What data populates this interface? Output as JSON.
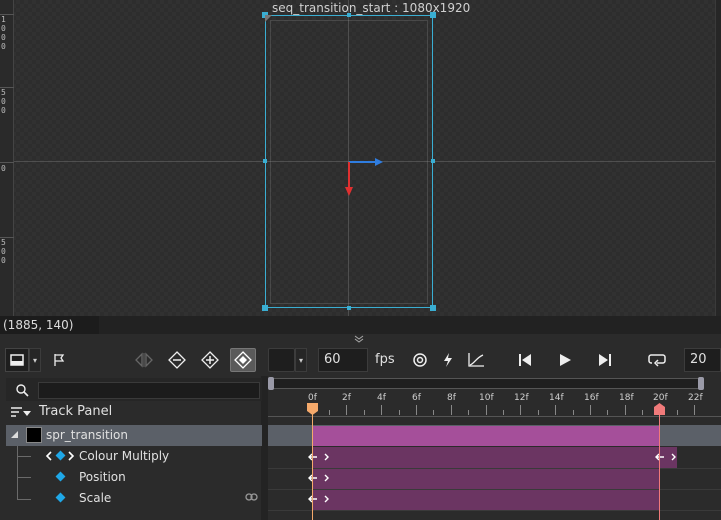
{
  "canvas": {
    "frame_title": "seq_transition_start : 1080x1920",
    "ruler_labels": [
      "1\n0\n0\n0",
      "5\n0\n0",
      "0",
      "5\n0\n0"
    ]
  },
  "status": {
    "coords": "(1885, 140)"
  },
  "toolbar": {
    "fps_value": "60",
    "fps_label": "fps",
    "end_frame": "20",
    "icons": [
      "panel-layout-icon",
      "flag-icon",
      "split-icon",
      "remove-keyframe-icon",
      "add-keyframe-icon",
      "record-keyframe-icon",
      "at-icon",
      "lightning-icon",
      "curve-icon",
      "skip-start-icon",
      "play-icon",
      "skip-end-icon",
      "loop-icon"
    ]
  },
  "track_panel": {
    "title": "Track Panel",
    "search_placeholder": "",
    "tracks": [
      {
        "label": "spr_transition"
      },
      {
        "label": "Colour Multiply"
      },
      {
        "label": "Position"
      },
      {
        "label": "Scale"
      }
    ]
  },
  "timeline": {
    "ruler_labels": [
      "0f",
      "2f",
      "4f",
      "6f",
      "8f",
      "10f",
      "12f",
      "14f",
      "16f",
      "18f",
      "20f",
      "22f"
    ]
  },
  "colors": {
    "accent": "#3aaed2",
    "clip_main": "#a54f9a",
    "clip_sub": "#6b3562",
    "playhead": "#f5a96b",
    "end_marker": "#f07a7a",
    "keyframe_diamond": "#1fa8e8"
  }
}
